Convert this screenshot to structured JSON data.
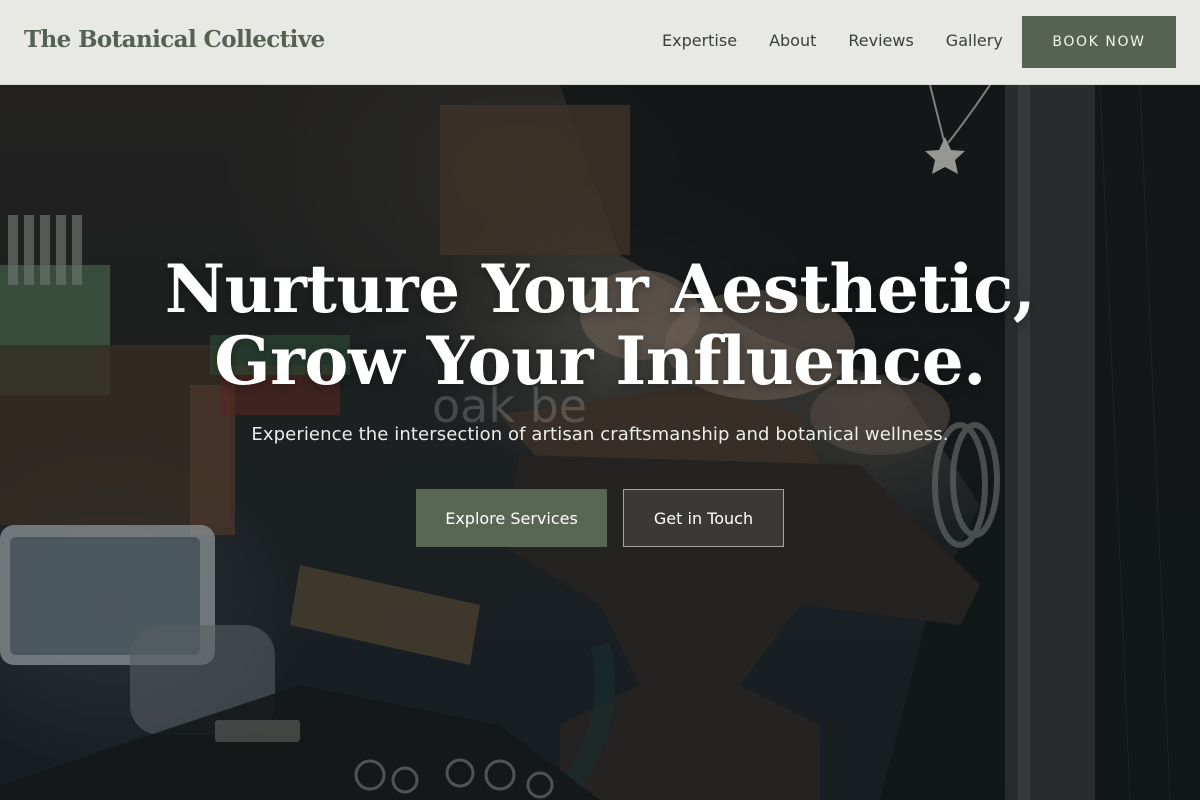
{
  "header": {
    "logo": "The Botanical Collective",
    "nav": [
      {
        "label": "Expertise"
      },
      {
        "label": "About"
      },
      {
        "label": "Reviews"
      },
      {
        "label": "Gallery"
      }
    ],
    "cta_label": "BOOK NOW"
  },
  "hero": {
    "title_line1": "Nurture Your Aesthetic,",
    "title_line2": "Grow Your Influence.",
    "subtitle": "Experience the intersection of artisan craftsmanship and botanical wellness.",
    "watermark": "oak be",
    "primary_cta": "Explore Services",
    "secondary_cta": "Get in Touch"
  },
  "colors": {
    "brand_green": "#566352",
    "header_bg": "#e8e9e5",
    "logo_text": "#556252"
  }
}
